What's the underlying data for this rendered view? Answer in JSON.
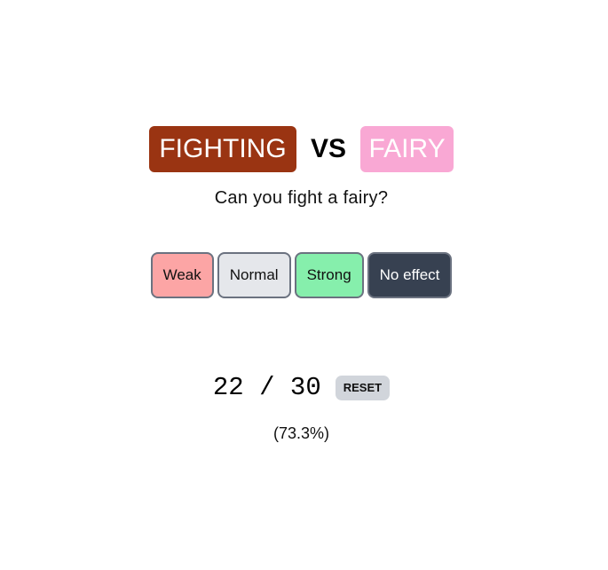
{
  "matchup": {
    "attacker": {
      "label": "FIGHTING",
      "color": "#9a3412"
    },
    "vs_label": "VS",
    "defender": {
      "label": "FAIRY",
      "color": "#f9a8d4"
    }
  },
  "question": "Can you fight a fairy?",
  "answers": [
    {
      "label": "Weak",
      "bg": "#fca5a5",
      "fg": "#111111"
    },
    {
      "label": "Normal",
      "bg": "#e5e7eb",
      "fg": "#111111"
    },
    {
      "label": "Strong",
      "bg": "#86efac",
      "fg": "#111111"
    },
    {
      "label": "No effect",
      "bg": "#374151",
      "fg": "#ffffff"
    }
  ],
  "score": {
    "text": "22 / 30",
    "correct": 22,
    "total": 30,
    "reset_label": "RESET",
    "percent_text": "(73.3%)"
  }
}
